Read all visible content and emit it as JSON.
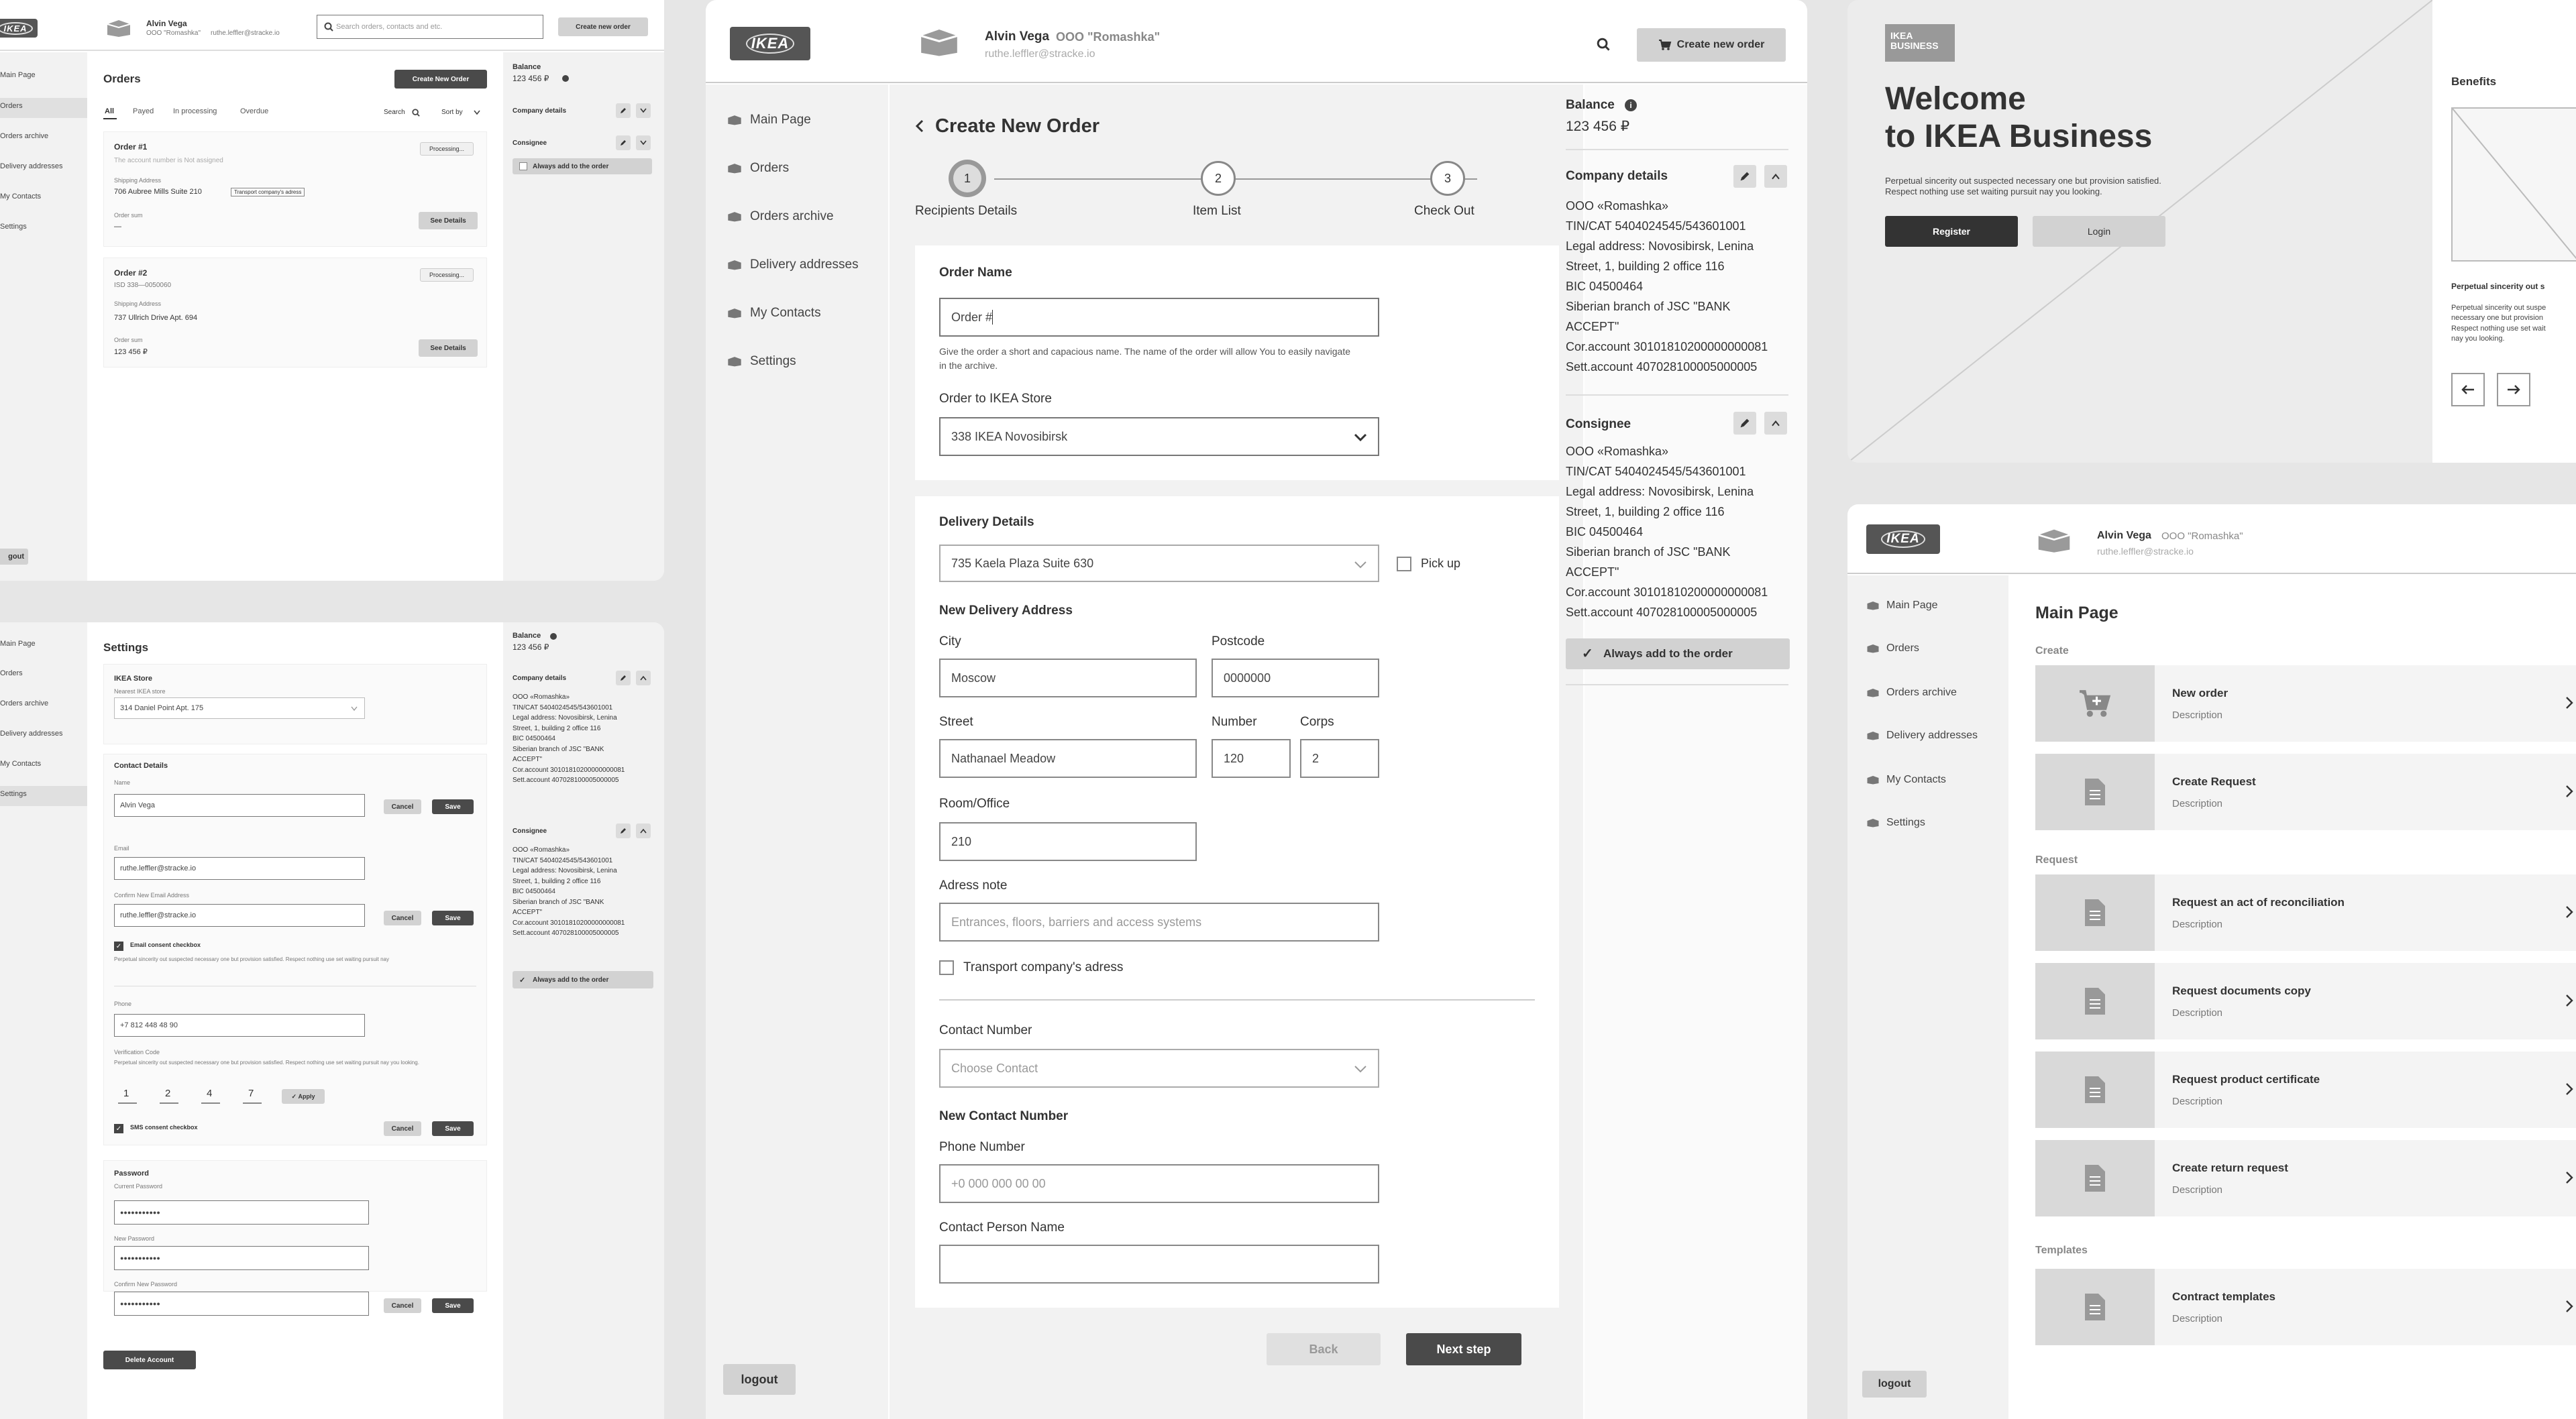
{
  "brand": {
    "logo": "IKEA",
    "business_logo": "IKEA BUSINESS"
  },
  "user": {
    "name": "Alvin Vega",
    "company": "OOO \"Romashka\"",
    "email": "ruthe.leffler@stracke.io"
  },
  "nav": {
    "main": "Main Page",
    "orders": "Orders",
    "archive": "Orders archive",
    "delivery": "Delivery addresses",
    "contacts": "My Contacts",
    "settings": "Settings",
    "logout": "logout",
    "logout_trunc": "gout"
  },
  "header": {
    "search_placeholder": "Search orders, contacts and etc.",
    "create_order": "Create new order"
  },
  "balance": {
    "label": "Balance",
    "value": "123 456 ₽"
  },
  "company": {
    "title": "Company details",
    "lines": [
      "OOO «Romashka»",
      "TIN/CAT 5404024545/543601001",
      "Legal address: Novosibirsk, Lenina",
      "Street, 1, building 2 office 116",
      "BIC 04500464",
      "Siberian branch of JSC \"BANK",
      "ACCEPT\"",
      "Cor.account 30101810200000000081",
      "Sett.account 40702810000500000​5"
    ]
  },
  "consignee": {
    "title": "Consignee",
    "lines": [
      "OOO «Romashka»",
      "TIN/CAT 5404024545/543601001",
      "Legal address: Novosibirsk, Lenina",
      "Street, 1, building 2 office 116",
      "BIC 04500464",
      "Siberian branch of JSC \"BANK",
      "ACCEPT\"",
      "Cor.account 30101810200000000081",
      "Sett.account 40702810000500000​5"
    ],
    "always": "Always add to the order"
  },
  "orders_panel": {
    "title": "Orders",
    "create": "Create New Order",
    "filters": [
      "All",
      "Payed",
      "In processing",
      "Overdue"
    ],
    "search": "Search",
    "sort": "Sort by",
    "o1": {
      "title": "Order #1",
      "sub": "The account number is Not assigned",
      "status": "Processing...",
      "ship_label": "Shipping Address",
      "ship": "706 Aubree Mills Suite 210",
      "transport": "Transport company's adress",
      "sum_label": "Order sum",
      "sum": "—",
      "details": "See Details"
    },
    "o2": {
      "title": "Order #2",
      "sub": "ISD 338—0050060",
      "status": "Processing...",
      "ship_label": "Shipping Address",
      "ship": "737 Ullrich Drive Apt. 694",
      "sum_label": "Order sum",
      "sum": "123 456 ₽",
      "details": "See Details"
    }
  },
  "settings": {
    "title": "Settings",
    "store_title": "IKEA Store",
    "store_label": "Nearest IKEA store",
    "store": "314 Daniel Point Apt. 175",
    "contact_title": "Contact Details",
    "name_label": "Name",
    "name": "Alvin Vega",
    "email_label": "Email",
    "email": "ruthe.leffler@stracke.io",
    "confirm_label": "Confirm New Email Address",
    "confirm": "ruthe.leffler@stracke.io",
    "email_consent": "Email consent checkbox",
    "consent_text": "Perpetual sincerity out suspected necessary one but provision satisfied. Respect nothing use set waiting pursuit nay",
    "phone_label": "Phone",
    "phone": "+7 812 448 48 90",
    "verif_label": "Verification Code",
    "verif_text": "Perpetual sincerity out suspected necessary one but provision satisfied. Respect nothing use set waiting pursuit nay you looking.",
    "code": [
      "1",
      "2",
      "4",
      "7"
    ],
    "apply": "Apply",
    "sms_consent": "SMS consent checkbox",
    "pw_title": "Password",
    "pw_current": "Current Password",
    "pw_new": "New Password",
    "pw_confirm": "Confirm New Password",
    "pw_dots": "●●●●●●●●●●●",
    "cancel": "Cancel",
    "save": "Save",
    "delete": "Delete Account"
  },
  "create_order": {
    "title": "Create New Order",
    "steps": [
      {
        "n": "1",
        "label": "Recipients Details"
      },
      {
        "n": "2",
        "label": "Item List"
      },
      {
        "n": "3",
        "label": "Check Out"
      }
    ],
    "order_name_title": "Order Name",
    "order_name_value": "Order #",
    "order_name_help": "Give the order a short and capacious name. The name of the order will allow You to easily navigate in the archive.",
    "store_label": "Order to IKEA Store",
    "store_value": "338 IKEA Novosibirsk",
    "delivery_title": "Delivery Details",
    "delivery_value": "735 Kaela Plaza Suite 630",
    "pickup": "Pick up",
    "new_addr": "New Delivery Address",
    "city_label": "City",
    "city": "Moscow",
    "postcode_label": "Postcode",
    "postcode": "0000000",
    "street_label": "Street",
    "street": "Nathanael Meadow",
    "number_label": "Number",
    "number": "120",
    "corps_label": "Corps",
    "corps": "2",
    "room_label": "Room/Office",
    "room": "210",
    "note_label": "Adress note",
    "note_ph": "Entrances, floors, barriers and access systems",
    "transport": "Transport company's adress",
    "contact_label": "Contact Number",
    "contact_ph": "Choose Contact",
    "new_contact": "New Contact Number",
    "phone_label": "Phone Number",
    "phone_ph": "+0 000 000 00 00",
    "person_label": "Contact Person Name",
    "back": "Back",
    "next": "Next step"
  },
  "welcome": {
    "title1": "Welcome",
    "title2": "to IKEA Business",
    "text1": "Perpetual sincerity out suspected necessary one but provision satisfied.",
    "text2": "Respect nothing use set waiting pursuit nay you looking.",
    "register": "Register",
    "login": "Login",
    "benefits": "Benefits",
    "b_title": "Perpetual sincerity out s",
    "b_text": [
      "Perpetual sincerity out suspe",
      "necessary one but provision",
      "Respect nothing use set wait",
      "nay you looking."
    ]
  },
  "main_page": {
    "title": "Main Page",
    "create": "Create",
    "request": "Request",
    "templates": "Templates",
    "desc": "Description",
    "items": [
      "New order",
      "Create Request",
      "Request an act of reconciliation",
      "Request documents copy",
      "Request product certificate",
      "Create return request",
      "Contract templates"
    ]
  },
  "icons": [
    "search-icon",
    "cart-icon",
    "box-icon",
    "document-icon",
    "pencil-icon",
    "chevron-up-icon",
    "chevron-down-icon",
    "chevron-right-icon",
    "arrow-left-icon",
    "arrow-right-icon",
    "info-icon",
    "check-icon"
  ]
}
